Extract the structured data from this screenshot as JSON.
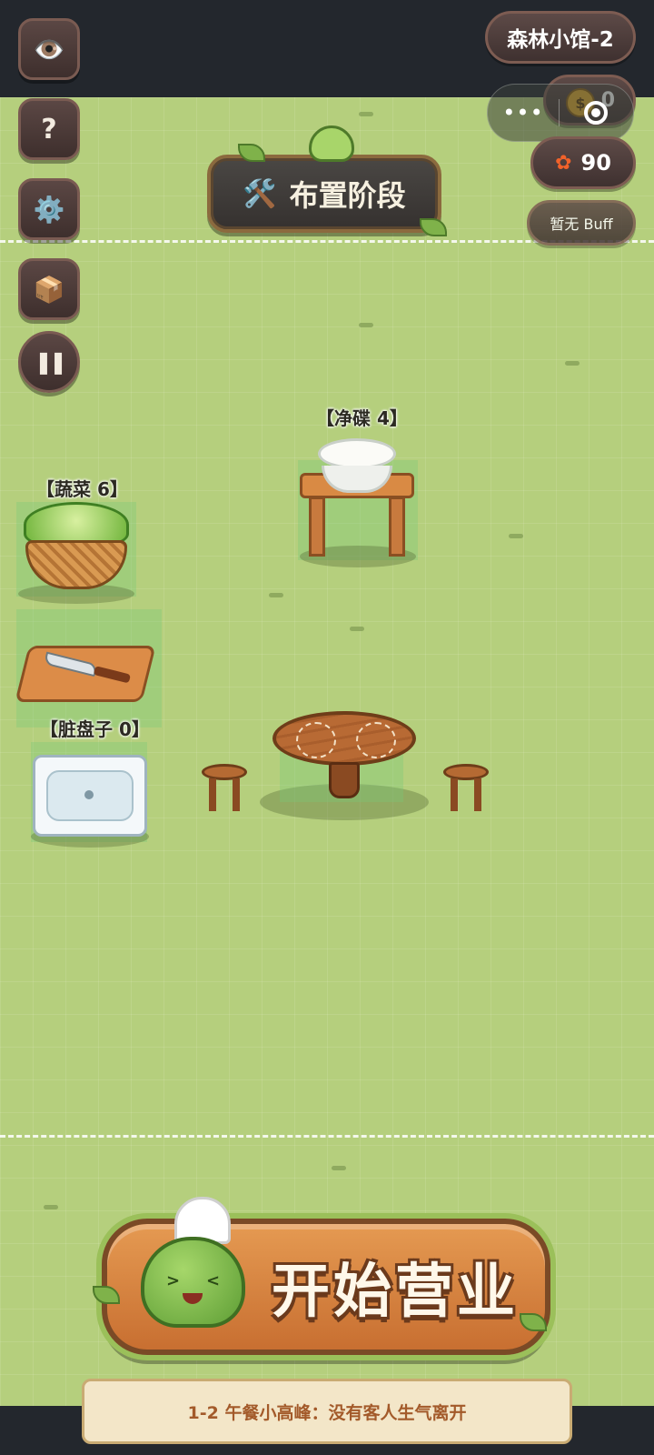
{
  "hud": {
    "level_name": "森林小馆-2",
    "coins": "0",
    "coin_symbol": "$",
    "flowers": "90",
    "buff": "暂无 Buff",
    "menu_dots": "•••"
  },
  "sidebar": {
    "eye_icon": "👁️",
    "help": "?",
    "settings_icon": "⚙️",
    "box_icon": "📦",
    "pause_icon": "❚❚"
  },
  "phase": {
    "icon": "🛠️",
    "title": "布置阶段"
  },
  "stations": {
    "plates": "【净碟 4】",
    "vegetables": "【蔬菜 6】",
    "dirty_plates": "【脏盘子 0】"
  },
  "action": {
    "start_label": "开始营业"
  },
  "objective": {
    "text": "1-2 午餐小高峰：没有客人生气离开"
  },
  "colors": {
    "grass": "#b5cf7d",
    "wood": "#c87a3e",
    "panel_dark": "#3f3130",
    "accent_text": "#a35a2a"
  }
}
